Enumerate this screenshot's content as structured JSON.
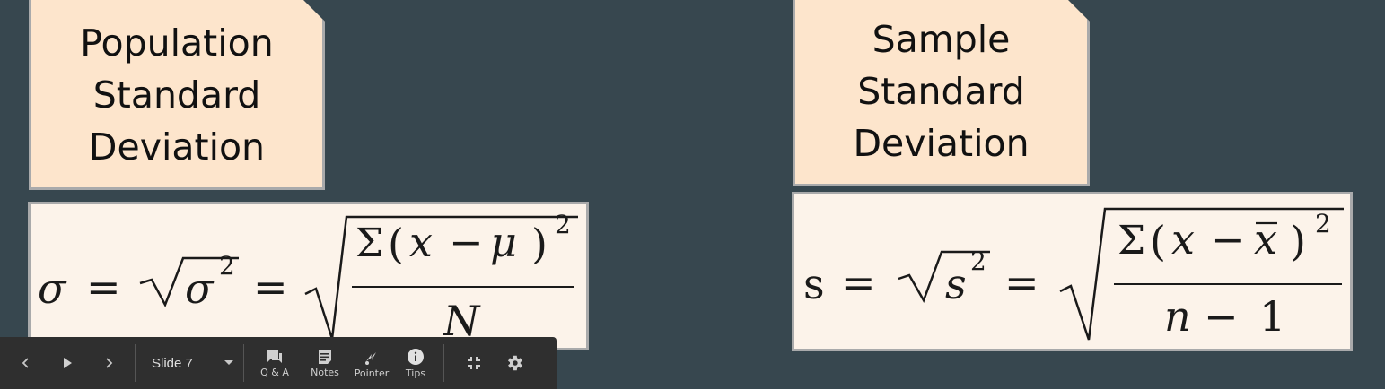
{
  "slide": {
    "left_card": {
      "lines": [
        "Population",
        "Standard",
        "Deviation"
      ]
    },
    "right_card": {
      "lines": [
        "Sample",
        "Standard",
        "Deviation"
      ]
    },
    "population_formula": {
      "lhs": "σ",
      "eq": "=",
      "radicand_base": "σ",
      "exp": "2",
      "sum": "Σ",
      "open": "(",
      "x": "x",
      "minus": "−",
      "mu": "μ",
      "close": ")",
      "denominator": "N"
    },
    "sample_formula": {
      "lhs": "s",
      "eq": "=",
      "radicand_base": "s",
      "exp": "2",
      "sum": "Σ",
      "open": "(",
      "x": "x",
      "minus": "−",
      "xbar": "x",
      "close": ")",
      "n": "n",
      "one": "1"
    }
  },
  "toolbar": {
    "slide_label": "Slide 7",
    "qa_label": "Q & A",
    "notes_label": "Notes",
    "pointer_label": "Pointer",
    "tips_label": "Tips"
  },
  "icons": [
    "chevron-left-icon",
    "play-icon",
    "chevron-right-icon",
    "caret-down-icon",
    "chat-icon",
    "notes-icon",
    "laser-pointer-icon",
    "info-icon",
    "exit-fullscreen-icon",
    "gear-icon"
  ],
  "colors": {
    "background": "#37474f",
    "card_fill": "#fde5cc",
    "formula_fill": "#fcf3ea",
    "border": "#a9aaab",
    "toolbar": "#2f2f2f"
  }
}
